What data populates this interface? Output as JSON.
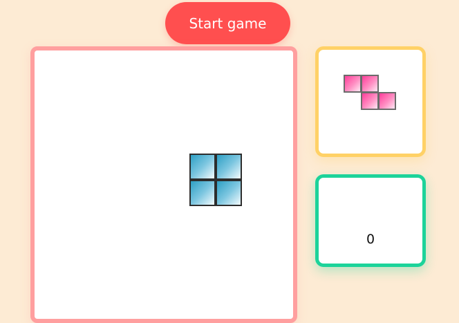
{
  "start_button": {
    "label": "Start game"
  },
  "board": {
    "current_piece": {
      "shape": "O",
      "color": "#2d9fc4"
    }
  },
  "next_piece": {
    "shape": "Z",
    "color": "#ff3d9a"
  },
  "score": {
    "value": "0"
  },
  "colors": {
    "background": "#fdebd4",
    "start_button": "#ff4f4f",
    "board_border": "#ff9f9f",
    "next_border": "#ffd166",
    "score_border": "#1cd39a"
  }
}
